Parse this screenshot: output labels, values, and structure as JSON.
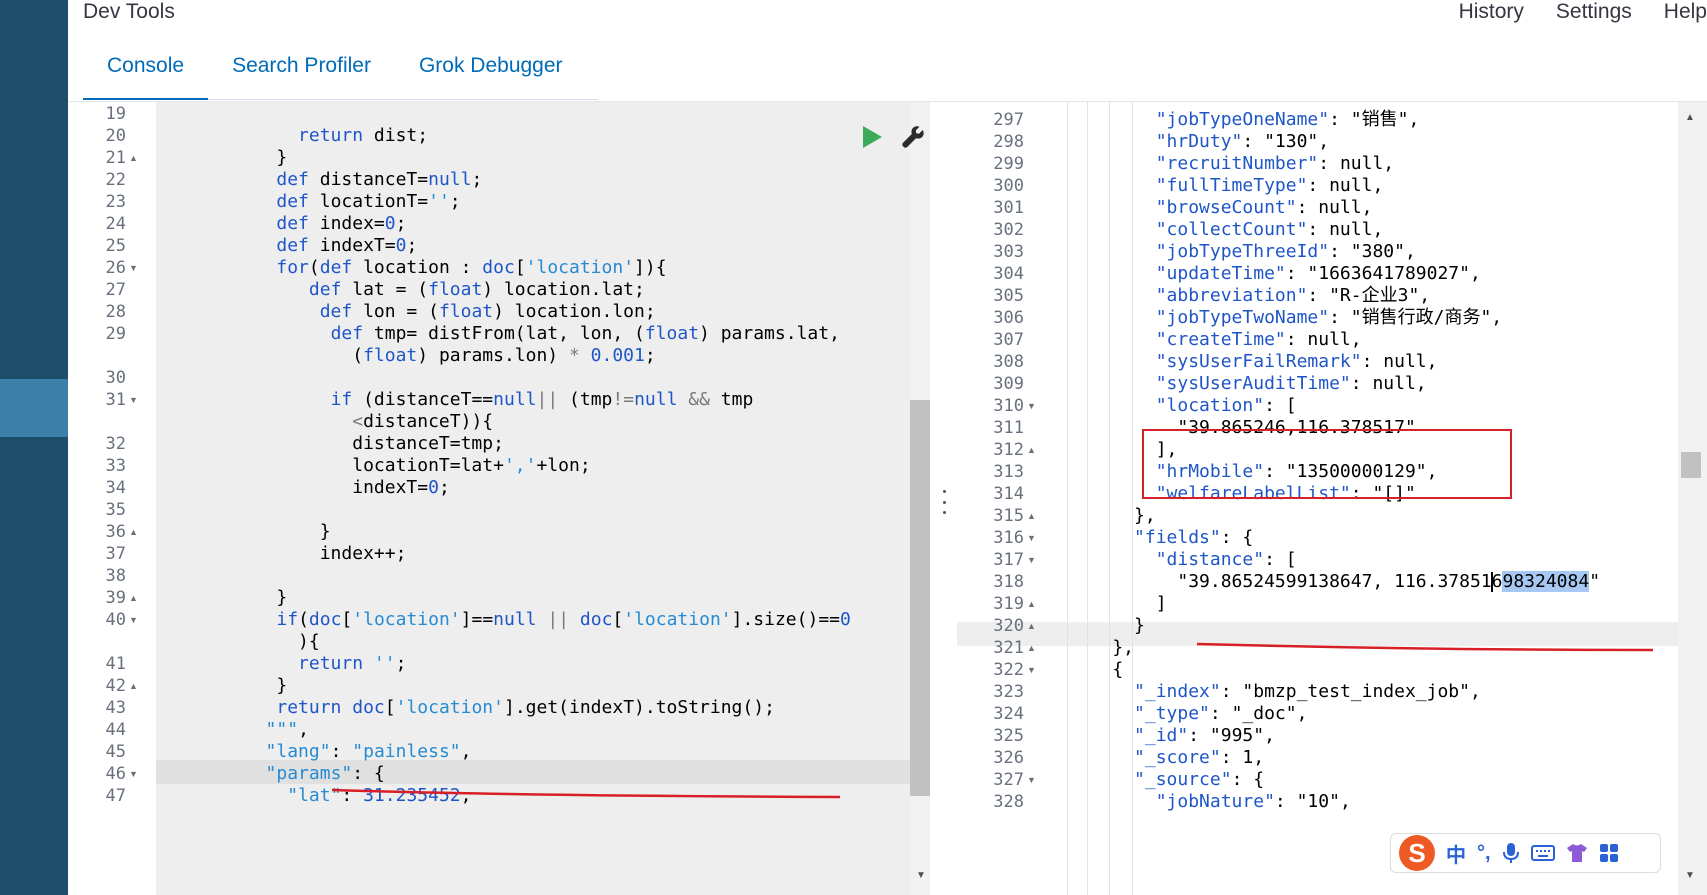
{
  "app": {
    "title": "Dev Tools"
  },
  "top_links": [
    "History",
    "Settings",
    "Help"
  ],
  "tabs": [
    "Console",
    "Search Profiler",
    "Grok Debugger"
  ],
  "ime": {
    "logo": "S",
    "mode": "中",
    "punct": "°,",
    "icons": [
      "microphone-icon",
      "keyboard-icon",
      "skin-icon",
      "apps-icon"
    ]
  },
  "colors": {
    "sidebar": "#1d4e6a",
    "accent": "#006bb8",
    "annotation": "#d81f27",
    "run": "#3caa5a"
  },
  "left_lines": [
    {
      "n": "19",
      "segs": []
    },
    {
      "n": "20",
      "segs": [
        [
          "            ",
          "plain"
        ],
        [
          "return",
          "kw"
        ],
        [
          " dist;",
          "plain"
        ]
      ]
    },
    {
      "n": "21",
      "fold": "up",
      "segs": [
        [
          "          }",
          "plain"
        ]
      ]
    },
    {
      "n": "22",
      "segs": [
        [
          "          ",
          "plain"
        ],
        [
          "def",
          "kw"
        ],
        [
          " distanceT=",
          "plain"
        ],
        [
          "null",
          "kw"
        ],
        [
          ";",
          "plain"
        ]
      ]
    },
    {
      "n": "23",
      "segs": [
        [
          "          ",
          "plain"
        ],
        [
          "def",
          "kw"
        ],
        [
          " locationT=",
          "plain"
        ],
        [
          "''",
          "str"
        ],
        [
          ";",
          "plain"
        ]
      ]
    },
    {
      "n": "24",
      "segs": [
        [
          "          ",
          "plain"
        ],
        [
          "def",
          "kw"
        ],
        [
          " index=",
          "plain"
        ],
        [
          "0",
          "num"
        ],
        [
          ";",
          "plain"
        ]
      ]
    },
    {
      "n": "25",
      "segs": [
        [
          "          ",
          "plain"
        ],
        [
          "def",
          "kw"
        ],
        [
          " indexT=",
          "plain"
        ],
        [
          "0",
          "num"
        ],
        [
          ";",
          "plain"
        ]
      ]
    },
    {
      "n": "26",
      "fold": "down",
      "segs": [
        [
          "          ",
          "plain"
        ],
        [
          "for",
          "kw"
        ],
        [
          "(",
          "plain"
        ],
        [
          "def",
          "kw"
        ],
        [
          " location : ",
          "plain"
        ],
        [
          "doc",
          "kw"
        ],
        [
          "[",
          "plain"
        ],
        [
          "'location'",
          "str"
        ],
        [
          "]){",
          "plain"
        ]
      ]
    },
    {
      "n": "27",
      "segs": [
        [
          "             ",
          "plain"
        ],
        [
          "def",
          "kw"
        ],
        [
          " lat = (",
          "plain"
        ],
        [
          "float",
          "kw"
        ],
        [
          ") location.lat;",
          "plain"
        ]
      ]
    },
    {
      "n": "28",
      "segs": [
        [
          "              ",
          "plain"
        ],
        [
          "def",
          "kw"
        ],
        [
          " lon = (",
          "plain"
        ],
        [
          "float",
          "kw"
        ],
        [
          ") location.lon;",
          "plain"
        ]
      ]
    },
    {
      "n": "29",
      "segs": [
        [
          "               ",
          "plain"
        ],
        [
          "def",
          "kw"
        ],
        [
          " tmp= distFrom(lat, lon, (",
          "plain"
        ],
        [
          "float",
          "kw"
        ],
        [
          ") params.lat,",
          "plain"
        ]
      ]
    },
    {
      "n": "",
      "segs": [
        [
          "                 (",
          "plain"
        ],
        [
          "float",
          "kw"
        ],
        [
          ") params.lon) ",
          "plain"
        ],
        [
          "*",
          "op"
        ],
        [
          " ",
          "plain"
        ],
        [
          "0.001",
          "num"
        ],
        [
          ";",
          "plain"
        ]
      ]
    },
    {
      "n": "30",
      "segs": []
    },
    {
      "n": "31",
      "fold": "down",
      "segs": [
        [
          "               ",
          "plain"
        ],
        [
          "if",
          "kw"
        ],
        [
          " (distanceT==",
          "plain"
        ],
        [
          "null",
          "kw"
        ],
        [
          "||",
          "op"
        ],
        [
          " (tmp",
          "plain"
        ],
        [
          "!=",
          "op"
        ],
        [
          "null",
          "kw"
        ],
        [
          " ",
          "plain"
        ],
        [
          "&&",
          "op"
        ],
        [
          " tmp",
          "plain"
        ]
      ]
    },
    {
      "n": "",
      "segs": [
        [
          "                 ",
          "plain"
        ],
        [
          "<",
          "op"
        ],
        [
          "distanceT)){",
          "plain"
        ]
      ]
    },
    {
      "n": "32",
      "segs": [
        [
          "                 distanceT=tmp;",
          "plain"
        ]
      ]
    },
    {
      "n": "33",
      "segs": [
        [
          "                 locationT=lat+",
          "plain"
        ],
        [
          "','",
          "str"
        ],
        [
          "+lon;",
          "plain"
        ]
      ]
    },
    {
      "n": "34",
      "segs": [
        [
          "                 indexT=",
          "plain"
        ],
        [
          "0",
          "num"
        ],
        [
          ";",
          "plain"
        ]
      ]
    },
    {
      "n": "35",
      "segs": []
    },
    {
      "n": "36",
      "fold": "up",
      "segs": [
        [
          "              }",
          "plain"
        ]
      ]
    },
    {
      "n": "37",
      "segs": [
        [
          "              index++;",
          "plain"
        ]
      ]
    },
    {
      "n": "38",
      "segs": []
    },
    {
      "n": "39",
      "fold": "up",
      "segs": [
        [
          "          }",
          "plain"
        ]
      ]
    },
    {
      "n": "40",
      "fold": "down",
      "segs": [
        [
          "          ",
          "plain"
        ],
        [
          "if",
          "kw"
        ],
        [
          "(",
          "plain"
        ],
        [
          "doc",
          "kw"
        ],
        [
          "[",
          "plain"
        ],
        [
          "'location'",
          "str"
        ],
        [
          "]==",
          "plain"
        ],
        [
          "null",
          "kw"
        ],
        [
          " ",
          "plain"
        ],
        [
          "||",
          "op"
        ],
        [
          " ",
          "plain"
        ],
        [
          "doc",
          "kw"
        ],
        [
          "[",
          "plain"
        ],
        [
          "'location'",
          "str"
        ],
        [
          "].size()==",
          "plain"
        ],
        [
          "0",
          "num"
        ]
      ]
    },
    {
      "n": "",
      "segs": [
        [
          "            ){",
          "plain"
        ]
      ]
    },
    {
      "n": "41",
      "segs": [
        [
          "            ",
          "plain"
        ],
        [
          "return",
          "kw"
        ],
        [
          " ",
          "plain"
        ],
        [
          "''",
          "str"
        ],
        [
          ";",
          "plain"
        ]
      ]
    },
    {
      "n": "42",
      "fold": "up",
      "segs": [
        [
          "          }",
          "plain"
        ]
      ]
    },
    {
      "n": "43",
      "segs": [
        [
          "          ",
          "plain"
        ],
        [
          "return",
          "kw"
        ],
        [
          " ",
          "plain"
        ],
        [
          "doc",
          "kw"
        ],
        [
          "[",
          "plain"
        ],
        [
          "'location'",
          "str"
        ],
        [
          "].get(indexT).toString();",
          "plain"
        ]
      ]
    },
    {
      "n": "44",
      "segs": [
        [
          "         ",
          "plain"
        ],
        [
          "\"\"\"",
          "str"
        ],
        [
          ",",
          "plain"
        ]
      ]
    },
    {
      "n": "45",
      "segs": [
        [
          "         ",
          "plain"
        ],
        [
          "\"lang\"",
          "str"
        ],
        [
          ": ",
          "plain"
        ],
        [
          "\"painless\"",
          "str"
        ],
        [
          ",",
          "plain"
        ]
      ]
    },
    {
      "n": "46",
      "fold": "down",
      "segs": [
        [
          "         ",
          "plain"
        ],
        [
          "\"params\"",
          "str"
        ],
        [
          ": {",
          "plain"
        ]
      ]
    },
    {
      "n": "47",
      "segs": [
        [
          "           ",
          "plain"
        ],
        [
          "\"lat\"",
          "str"
        ],
        [
          ": ",
          "plain"
        ],
        [
          "31.235452",
          "num"
        ],
        [
          ",",
          "plain"
        ]
      ]
    }
  ],
  "right_lines": [
    {
      "n": "297",
      "segs": [
        [
          "        ",
          "plain"
        ],
        [
          "\"jobTypeOneName\"",
          "json-key"
        ],
        [
          ": \"销售\",",
          "json-str"
        ]
      ]
    },
    {
      "n": "298",
      "segs": [
        [
          "        ",
          "plain"
        ],
        [
          "\"hrDuty\"",
          "json-key"
        ],
        [
          ": \"130\",",
          "json-str"
        ]
      ]
    },
    {
      "n": "299",
      "segs": [
        [
          "        ",
          "plain"
        ],
        [
          "\"recruitNumber\"",
          "json-key"
        ],
        [
          ": null,",
          "json-null"
        ]
      ]
    },
    {
      "n": "300",
      "segs": [
        [
          "        ",
          "plain"
        ],
        [
          "\"fullTimeType\"",
          "json-key"
        ],
        [
          ": null,",
          "json-null"
        ]
      ]
    },
    {
      "n": "301",
      "segs": [
        [
          "        ",
          "plain"
        ],
        [
          "\"browseCount\"",
          "json-key"
        ],
        [
          ": null,",
          "json-null"
        ]
      ]
    },
    {
      "n": "302",
      "segs": [
        [
          "        ",
          "plain"
        ],
        [
          "\"collectCount\"",
          "json-key"
        ],
        [
          ": null,",
          "json-null"
        ]
      ]
    },
    {
      "n": "303",
      "segs": [
        [
          "        ",
          "plain"
        ],
        [
          "\"jobTypeThreeId\"",
          "json-key"
        ],
        [
          ": \"380\",",
          "json-str"
        ]
      ]
    },
    {
      "n": "304",
      "segs": [
        [
          "        ",
          "plain"
        ],
        [
          "\"updateTime\"",
          "json-key"
        ],
        [
          ": \"1663641789027\",",
          "json-str"
        ]
      ]
    },
    {
      "n": "305",
      "segs": [
        [
          "        ",
          "plain"
        ],
        [
          "\"abbreviation\"",
          "json-key"
        ],
        [
          ": \"R-企业3\",",
          "json-str"
        ]
      ]
    },
    {
      "n": "306",
      "segs": [
        [
          "        ",
          "plain"
        ],
        [
          "\"jobTypeTwoName\"",
          "json-key"
        ],
        [
          ": \"销售行政/商务\",",
          "json-str"
        ]
      ]
    },
    {
      "n": "307",
      "segs": [
        [
          "        ",
          "plain"
        ],
        [
          "\"createTime\"",
          "json-key"
        ],
        [
          ": null,",
          "json-null"
        ]
      ]
    },
    {
      "n": "308",
      "segs": [
        [
          "        ",
          "plain"
        ],
        [
          "\"sysUserFailRemark\"",
          "json-key"
        ],
        [
          ": null,",
          "json-null"
        ]
      ]
    },
    {
      "n": "309",
      "segs": [
        [
          "        ",
          "plain"
        ],
        [
          "\"sysUserAuditTime\"",
          "json-key"
        ],
        [
          ": null,",
          "json-null"
        ]
      ]
    },
    {
      "n": "310",
      "fold": "down",
      "segs": [
        [
          "        ",
          "plain"
        ],
        [
          "\"location\"",
          "json-key"
        ],
        [
          ": [",
          "plain"
        ]
      ]
    },
    {
      "n": "311",
      "segs": [
        [
          "          \"39.865246,116.378517\"",
          "json-str"
        ]
      ]
    },
    {
      "n": "312",
      "fold": "up",
      "segs": [
        [
          "        ],",
          "plain"
        ]
      ]
    },
    {
      "n": "313",
      "segs": [
        [
          "        ",
          "plain"
        ],
        [
          "\"hrMobile\"",
          "json-key"
        ],
        [
          ": \"13500000129\",",
          "json-str"
        ]
      ]
    },
    {
      "n": "314",
      "segs": [
        [
          "        ",
          "plain"
        ],
        [
          "\"welfareLabelList\"",
          "json-key"
        ],
        [
          ": \"[]\"",
          "json-str"
        ]
      ]
    },
    {
      "n": "315",
      "fold": "up",
      "segs": [
        [
          "      },",
          "plain"
        ]
      ]
    },
    {
      "n": "316",
      "fold": "down",
      "segs": [
        [
          "      ",
          "plain"
        ],
        [
          "\"fields\"",
          "json-key"
        ],
        [
          ": {",
          "plain"
        ]
      ]
    },
    {
      "n": "317",
      "fold": "down",
      "segs": [
        [
          "        ",
          "plain"
        ],
        [
          "\"distance\"",
          "json-key"
        ],
        [
          ": [",
          "plain"
        ]
      ]
    },
    {
      "n": "318",
      "segs": [
        [
          "          \"39.86524599138647, 116.37851",
          "json-str"
        ],
        [
          "|",
          "cursor"
        ],
        [
          "6",
          "json-str"
        ],
        [
          "98324084",
          "selected"
        ],
        [
          "\"",
          "json-str"
        ]
      ]
    },
    {
      "n": "319",
      "fold": "up",
      "segs": [
        [
          "        ]",
          "plain"
        ]
      ]
    },
    {
      "n": "320",
      "fold": "up",
      "segs": [
        [
          "      }",
          "plain"
        ]
      ]
    },
    {
      "n": "321",
      "fold": "up",
      "segs": [
        [
          "    },",
          "plain"
        ]
      ]
    },
    {
      "n": "322",
      "fold": "down",
      "segs": [
        [
          "    {",
          "plain"
        ]
      ]
    },
    {
      "n": "323",
      "segs": [
        [
          "      ",
          "plain"
        ],
        [
          "\"_index\"",
          "json-key"
        ],
        [
          ": \"bmzp_test_index_job\",",
          "json-str"
        ]
      ]
    },
    {
      "n": "324",
      "segs": [
        [
          "      ",
          "plain"
        ],
        [
          "\"_type\"",
          "json-key"
        ],
        [
          ": \"_doc\",",
          "json-str"
        ]
      ]
    },
    {
      "n": "325",
      "segs": [
        [
          "      ",
          "plain"
        ],
        [
          "\"_id\"",
          "json-key"
        ],
        [
          ": \"995\",",
          "json-str"
        ]
      ]
    },
    {
      "n": "326",
      "segs": [
        [
          "      ",
          "plain"
        ],
        [
          "\"_score\"",
          "json-key"
        ],
        [
          ": 1,",
          "json-str"
        ]
      ]
    },
    {
      "n": "327",
      "fold": "down",
      "segs": [
        [
          "      ",
          "plain"
        ],
        [
          "\"_source\"",
          "json-key"
        ],
        [
          ": {",
          "plain"
        ]
      ]
    },
    {
      "n": "328",
      "segs": [
        [
          "        ",
          "plain"
        ],
        [
          "\"jobNature\"",
          "json-key"
        ],
        [
          ": \"10\",",
          "json-str"
        ]
      ]
    }
  ]
}
